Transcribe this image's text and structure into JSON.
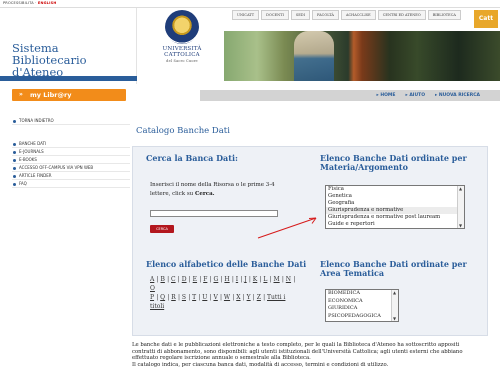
{
  "top": {
    "lang_label": "PROCESSIBILITA",
    "lang_sep": "·",
    "lang_current": "ENGLISH"
  },
  "header": {
    "site_title": [
      "Sistema",
      "Bibliotecario",
      "d'Ateneo"
    ],
    "university_name": [
      "UNIVERSITÀ",
      "CATTOLICA"
    ],
    "university_sub": "del Sacro Cuore",
    "topnav": [
      "UNICATT",
      "DOCENTI",
      "SEDI",
      "FACOLTÀ",
      "ACHACCLISE",
      "CENTRI ED ATENEO",
      "BIBLIOTECA"
    ],
    "badge": "Catt"
  },
  "mylib": {
    "label": "my Libr@ry"
  },
  "nav": {
    "home": "HOME",
    "help": "AIUTO",
    "new_search": "NUOVA RICERCA"
  },
  "sidebar": {
    "back": "TORNA INDIETRO",
    "items": [
      "BANCHE DATI",
      "E-JOURNALS",
      "E-BOOKS",
      "ACCESSO OFF-CAMPUS VIA VPN WEB",
      "ARTICLE FINDER",
      "FAQ"
    ]
  },
  "main": {
    "page_title": "Catalogo Banche Dati",
    "search": {
      "heading": "Cerca la Banca Dati:",
      "instruction_1": "Inserisci il nome della Risorsa o le prime 3-4",
      "instruction_2": "lettere, click su ",
      "instruction_bold": "Cerca.",
      "input_value": "",
      "button": "CERCA"
    },
    "by_subject": {
      "heading_1": "Elenco Banche Dati ordinate per",
      "heading_2": "Materia/Argomento",
      "options": [
        "Fisica",
        "Genetica",
        "Geografia",
        "Giurisprudenza e normative",
        "Giurisprudenza e normative post lauream",
        "Guide e repertori"
      ]
    },
    "alphabetical": {
      "heading": "Elenco alfabetico delle Banche Dati",
      "letters_1": [
        "A",
        "B",
        "C",
        "D",
        "E",
        "F",
        "G",
        "H",
        "I",
        "J",
        "K",
        "L",
        "M",
        "N",
        "O"
      ],
      "letters_2": [
        "P",
        "Q",
        "R",
        "S",
        "T",
        "U",
        "V",
        "W",
        "X",
        "Y",
        "Z"
      ],
      "all_titles": "Tutti i titoli"
    },
    "by_area": {
      "heading_1": "Elenco Banche Dati ordinate per",
      "heading_2": "Area Tematica",
      "options": [
        "BIOMEDICA",
        "ECONOMICA",
        "GIURIDICA",
        "PSICOPEDAGOGICA"
      ]
    },
    "footer": [
      "Le banche dati e le pubblicazioni elettroniche a testo completo, per le quali la Biblioteca d'Ateneo ha sottoscritto appositi",
      "contratti di abbonamento, sono disponibili: agli utenti istituzionali dell'Università Cattolica; agli utenti esterni che abbiano",
      "effettuato regolare iscrizione annuale o semestrale alla Biblioteca.",
      "Il catalogo indica, per ciascuna banca dati, modalità di accesso, termini e condizioni di utilizzo."
    ]
  },
  "colors": {
    "brand_blue": "#2a5d9a",
    "accent_orange": "#f28c1a",
    "button_red": "#b3171e",
    "panel_bg": "#eef1f6"
  }
}
